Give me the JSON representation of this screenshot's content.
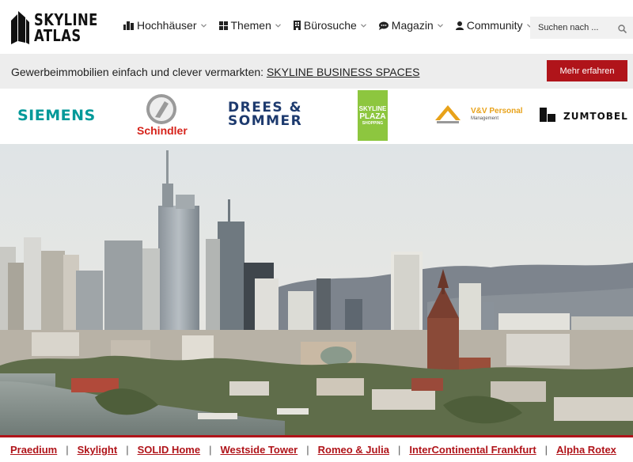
{
  "logo": {
    "line1": "SKYLINE",
    "line2": "ATLAS"
  },
  "nav": [
    {
      "label": "Hochhäuser",
      "icon": "buildings-icon"
    },
    {
      "label": "Themen",
      "icon": "grid-icon"
    },
    {
      "label": "Bürosuche",
      "icon": "office-icon"
    },
    {
      "label": "Magazin",
      "icon": "chat-icon"
    },
    {
      "label": "Community",
      "icon": "user-icon"
    }
  ],
  "search": {
    "placeholder": "Suchen nach ..."
  },
  "promo": {
    "text": "Gewerbeimmobilien einfach und clever vermarkten: ",
    "link": "SKYLINE BUSINESS SPACES",
    "button": "Mehr erfahren"
  },
  "sponsors": {
    "siemens": "SIEMENS",
    "schindler": "Schindler",
    "drees1": "DREES &",
    "drees2": "SOMMER",
    "plaza1": "SKYLINE",
    "plaza2": "PLAZA",
    "plaza3": "SHOPPING",
    "vv1": "V&V Personal",
    "vv2": "Management",
    "zumtobel": "ZUMTOBEL"
  },
  "links": [
    "Praedium",
    "Skylight",
    "SOLID Home",
    "Westside Tower",
    "Romeo & Julia",
    "InterContinental Frankfurt",
    "Alpha Rotex"
  ],
  "colors": {
    "accent": "#b0141a",
    "siemens": "#009999",
    "drees": "#1d3a6e",
    "plaza": "#8dc63f",
    "vv": "#e8a21a"
  }
}
